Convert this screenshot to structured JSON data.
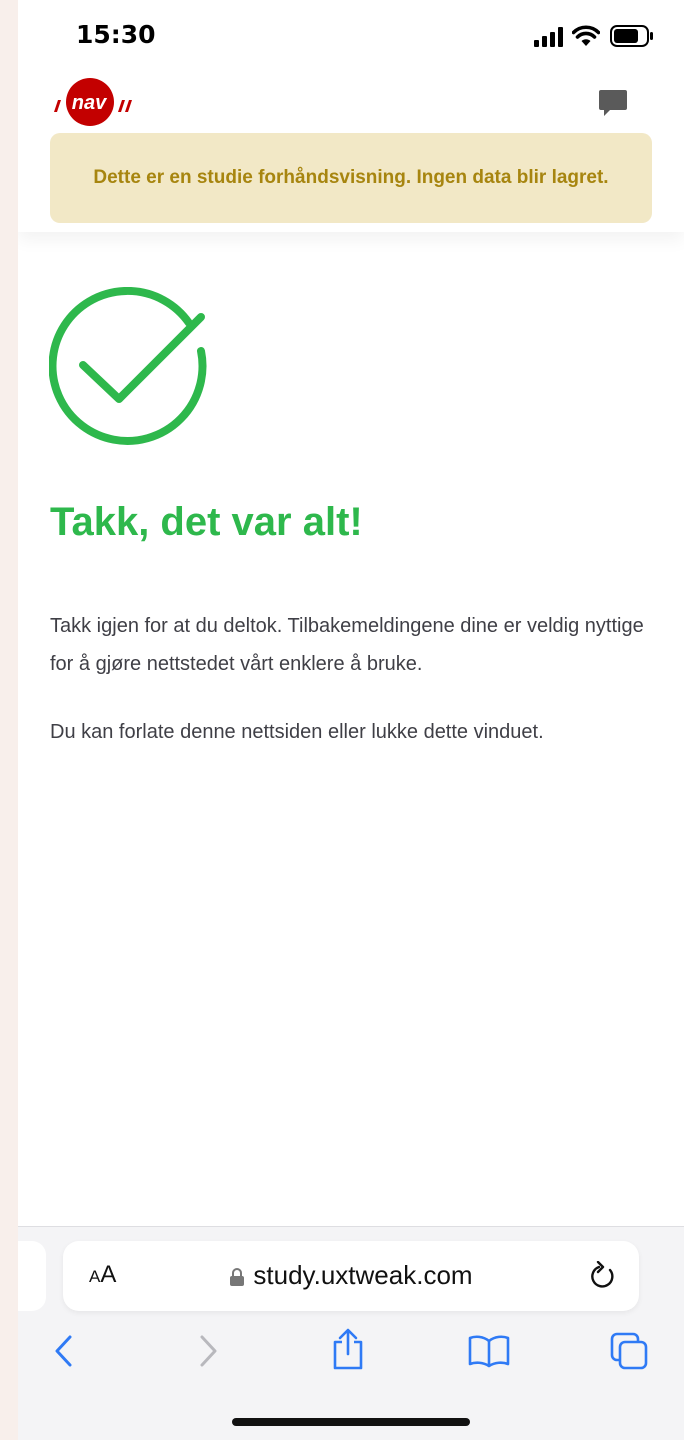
{
  "status_bar": {
    "time": "15:30"
  },
  "header": {
    "logo_text": "nav",
    "banner_text": "Dette er en studie forhåndsvisning. Ingen data blir lagret."
  },
  "content": {
    "title": "Takk, det var alt!",
    "paragraph_1": "Takk igjen for at du deltok. Tilbakemeldingene dine er veldig nyttige for å gjøre nettstedet vårt enklere å bruke.",
    "paragraph_2": "Du kan forlate denne nettsiden eller lukke dette vinduet."
  },
  "browser": {
    "text_size_label_small": "A",
    "text_size_label_large": "A",
    "url": "study.uxtweak.com"
  },
  "colors": {
    "success_green": "#2eb84c",
    "banner_bg": "#f2e8c6",
    "banner_text": "#a7850f",
    "nav_red": "#c30000",
    "safari_blue": "#2f7af5"
  },
  "icons": [
    "signal-icon",
    "wifi-icon",
    "battery-icon",
    "chat-icon",
    "checkmark-circle-icon",
    "lock-icon",
    "reload-icon",
    "back-icon",
    "forward-icon",
    "share-icon",
    "bookmarks-icon",
    "tabs-icon"
  ]
}
